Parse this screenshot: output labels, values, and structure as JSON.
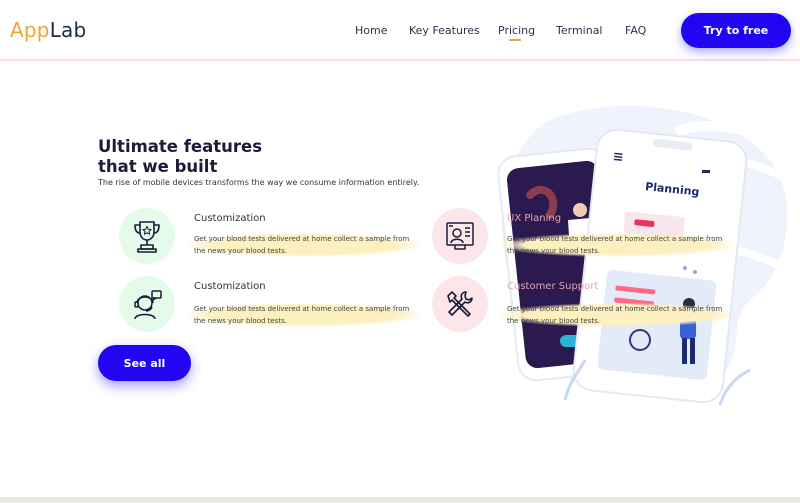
{
  "header": {
    "logo_part1": "App",
    "logo_part2": "Lab",
    "nav": [
      "Home",
      "Key Features",
      "Pricing",
      "Terminal",
      "FAQ"
    ],
    "cta_label": "Try to free"
  },
  "hero": {
    "title_line1": "Ultimate features",
    "title_line2": "that we built",
    "subtitle": "The rise of mobile devices transforms the way we consume information entirely.",
    "see_all_label": "See all"
  },
  "features": [
    {
      "title": "Customization",
      "desc": "Get your blood tests delivered at home collect a sample from the news your blood tests.",
      "icon": "trophy-icon"
    },
    {
      "title": "UX Planing",
      "desc": "Get your blood tests delivered at home collect a sample from the news your blood tests.",
      "icon": "profile-board-icon"
    },
    {
      "title": "Customization",
      "desc": "Get your blood tests delivered at home collect a sample from the news your blood tests.",
      "icon": "support-agent-icon"
    },
    {
      "title": "Customer Support",
      "desc": "Get your blood tests delivered at home collect a sample from the news your blood tests.",
      "icon": "tools-icon"
    }
  ],
  "illustration": {
    "phone_heading": "Planning"
  },
  "colors": {
    "accent": "#2206f2",
    "logo_orange": "#f4a13b",
    "icon_green_bg": "#e4fbe9",
    "icon_pink_bg": "#fde6ea",
    "highlight_yellow": "#fdf0c0"
  }
}
